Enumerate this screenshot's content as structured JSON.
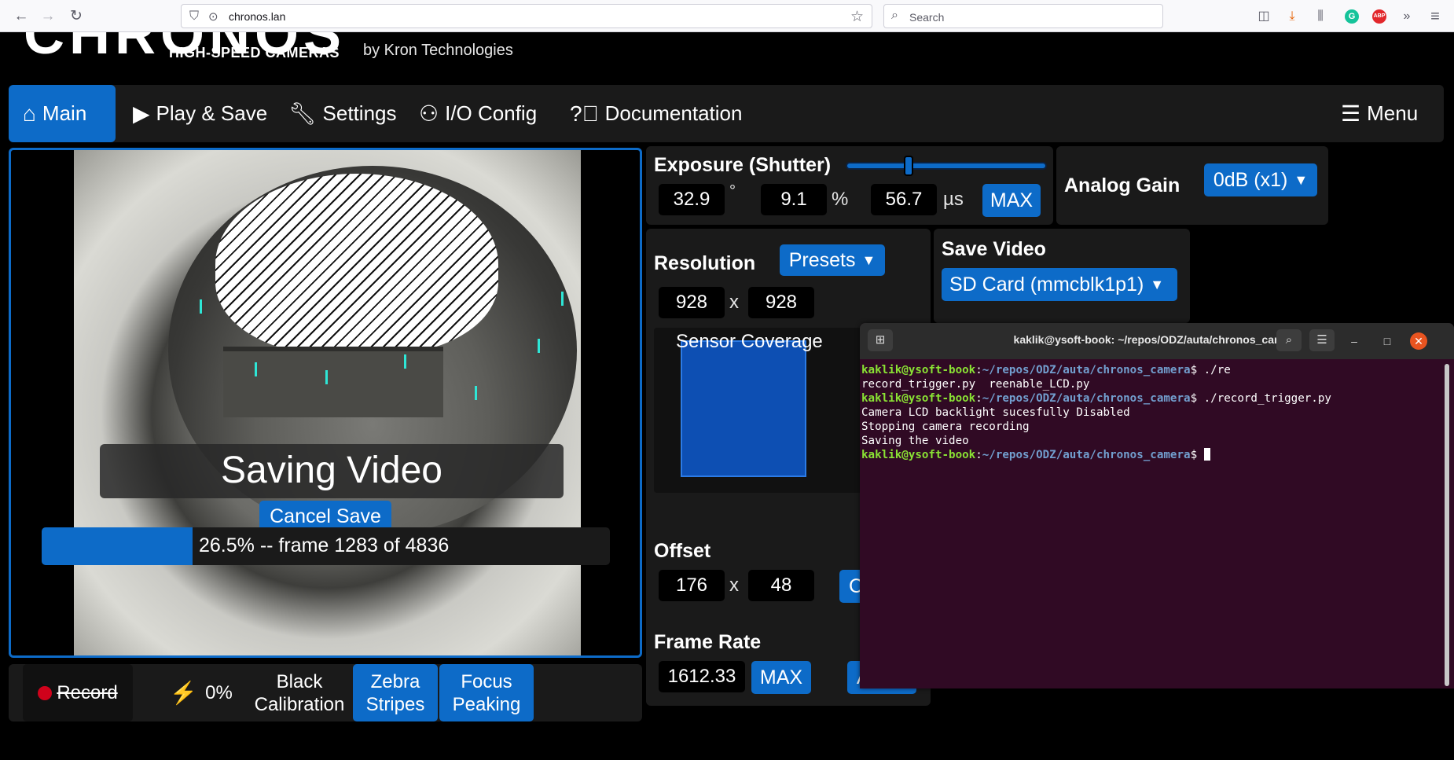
{
  "browser": {
    "url": "chronos.lan",
    "search_placeholder": "Search"
  },
  "header": {
    "logo_text": "CHRONOS",
    "logo_sub": "HIGH-SPEED CAMERAS",
    "by": "by Kron Technologies"
  },
  "nav": {
    "main": "Main",
    "play_save": "Play & Save",
    "settings": "Settings",
    "io_config": "I/O Config",
    "documentation": "Documentation",
    "menu": "Menu"
  },
  "exposure": {
    "label": "Exposure (Shutter)",
    "degrees": "32.9",
    "degrees_unit": "°",
    "percent": "9.1",
    "percent_unit": "%",
    "microseconds": "56.7",
    "us_unit": "µs",
    "max_label": "MAX",
    "slider_fraction": 0.31
  },
  "analog_gain": {
    "label": "Analog Gain",
    "value": "0dB (x1)"
  },
  "resolution": {
    "label": "Resolution",
    "presets_label": "Presets",
    "width": "928",
    "height": "928",
    "x_sep": "x",
    "sensor_coverage_label": "Sensor Coverage"
  },
  "save_video": {
    "label": "Save Video",
    "device": "SD Card (mmcblk1p1)"
  },
  "offset": {
    "label": "Offset",
    "x": "176",
    "y": "48",
    "x_sep": "x",
    "center_partial": "C"
  },
  "frame_rate": {
    "label": "Frame Rate",
    "value": "1612.33",
    "max_label": "MAX",
    "extra_partial": "A"
  },
  "preview": {
    "saving_title": "Saving Video",
    "cancel_label": "Cancel Save",
    "progress_text": "26.5% -- frame 1283 of 4836",
    "progress_fraction": 0.265
  },
  "bottom_bar": {
    "record_label": "Record",
    "battery_label": "0%",
    "black_cal_label": "Black Calibration",
    "zebra_label": "Zebra Stripes",
    "focus_label": "Focus Peaking"
  },
  "terminal": {
    "title": "kaklik@ysoft-book: ~/repos/ODZ/auta/chronos_camera",
    "user_host": "kaklik@ysoft-book",
    "path": "~/repos/ODZ/auta/chronos_camera",
    "cmd1": "$ ./re",
    "line2": "record_trigger.py  reenable_LCD.py",
    "cmd2": "$ ./record_trigger.py",
    "out1": "Camera LCD backlight sucesfully Disabled",
    "out2": "Stopping camera recording",
    "out3": "Saving the video",
    "prompt_end": "$ "
  }
}
